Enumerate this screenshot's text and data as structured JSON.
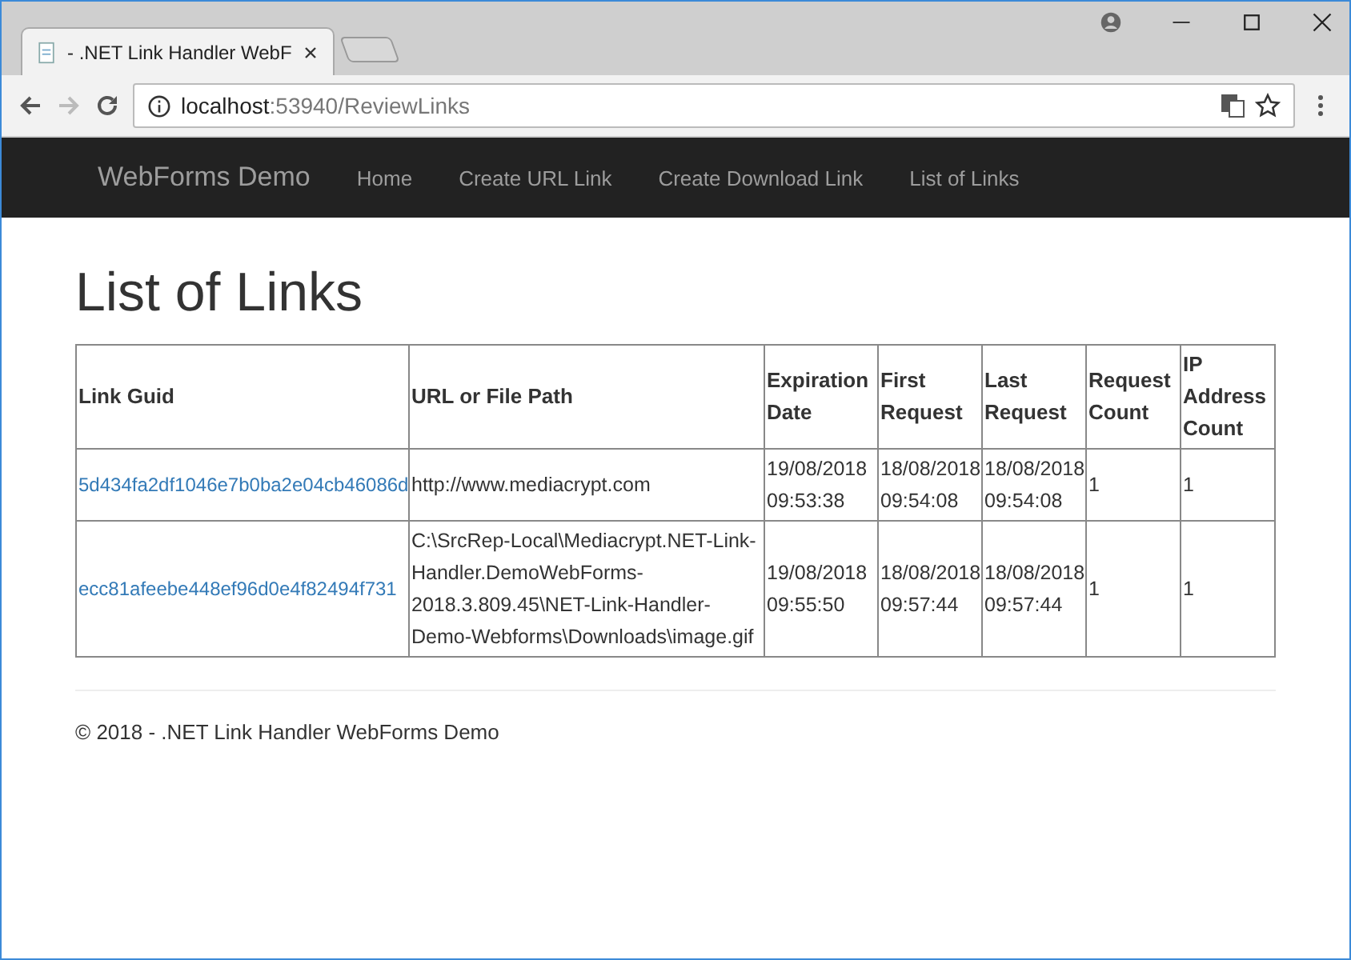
{
  "browser": {
    "tab_title": "- .NET Link Handler WebF",
    "address_host": "localhost",
    "address_path": ":53940/ReviewLinks"
  },
  "navbar": {
    "brand": "WebForms Demo",
    "items": [
      {
        "label": "Home"
      },
      {
        "label": "Create URL Link"
      },
      {
        "label": "Create Download Link"
      },
      {
        "label": "List of Links"
      }
    ]
  },
  "page_title": "List of Links",
  "table": {
    "columns": [
      "Link Guid",
      "URL or File Path",
      "Expiration Date",
      "First Request",
      "Last Request",
      "Request Count",
      "IP Address Count"
    ],
    "rows": [
      [
        "5d434fa2df1046e7b0ba2e04cb46086d",
        "http://www.mediacrypt.com",
        "19/08/2018 09:53:38",
        "18/08/2018 09:54:08",
        "18/08/2018 09:54:08",
        "1",
        "1"
      ],
      [
        "ecc81afeebe448ef96d0e4f82494f731",
        "C:\\SrcRep-Local\\Mediacrypt.NET-Link-Handler.DemoWebForms-2018.3.809.45\\NET-Link-Handler-Demo-Webforms\\Downloads\\image.gif",
        "19/08/2018 09:55:50",
        "18/08/2018 09:57:44",
        "18/08/2018 09:57:44",
        "1",
        "1"
      ]
    ]
  },
  "footer": "© 2018 - .NET Link Handler WebForms Demo"
}
